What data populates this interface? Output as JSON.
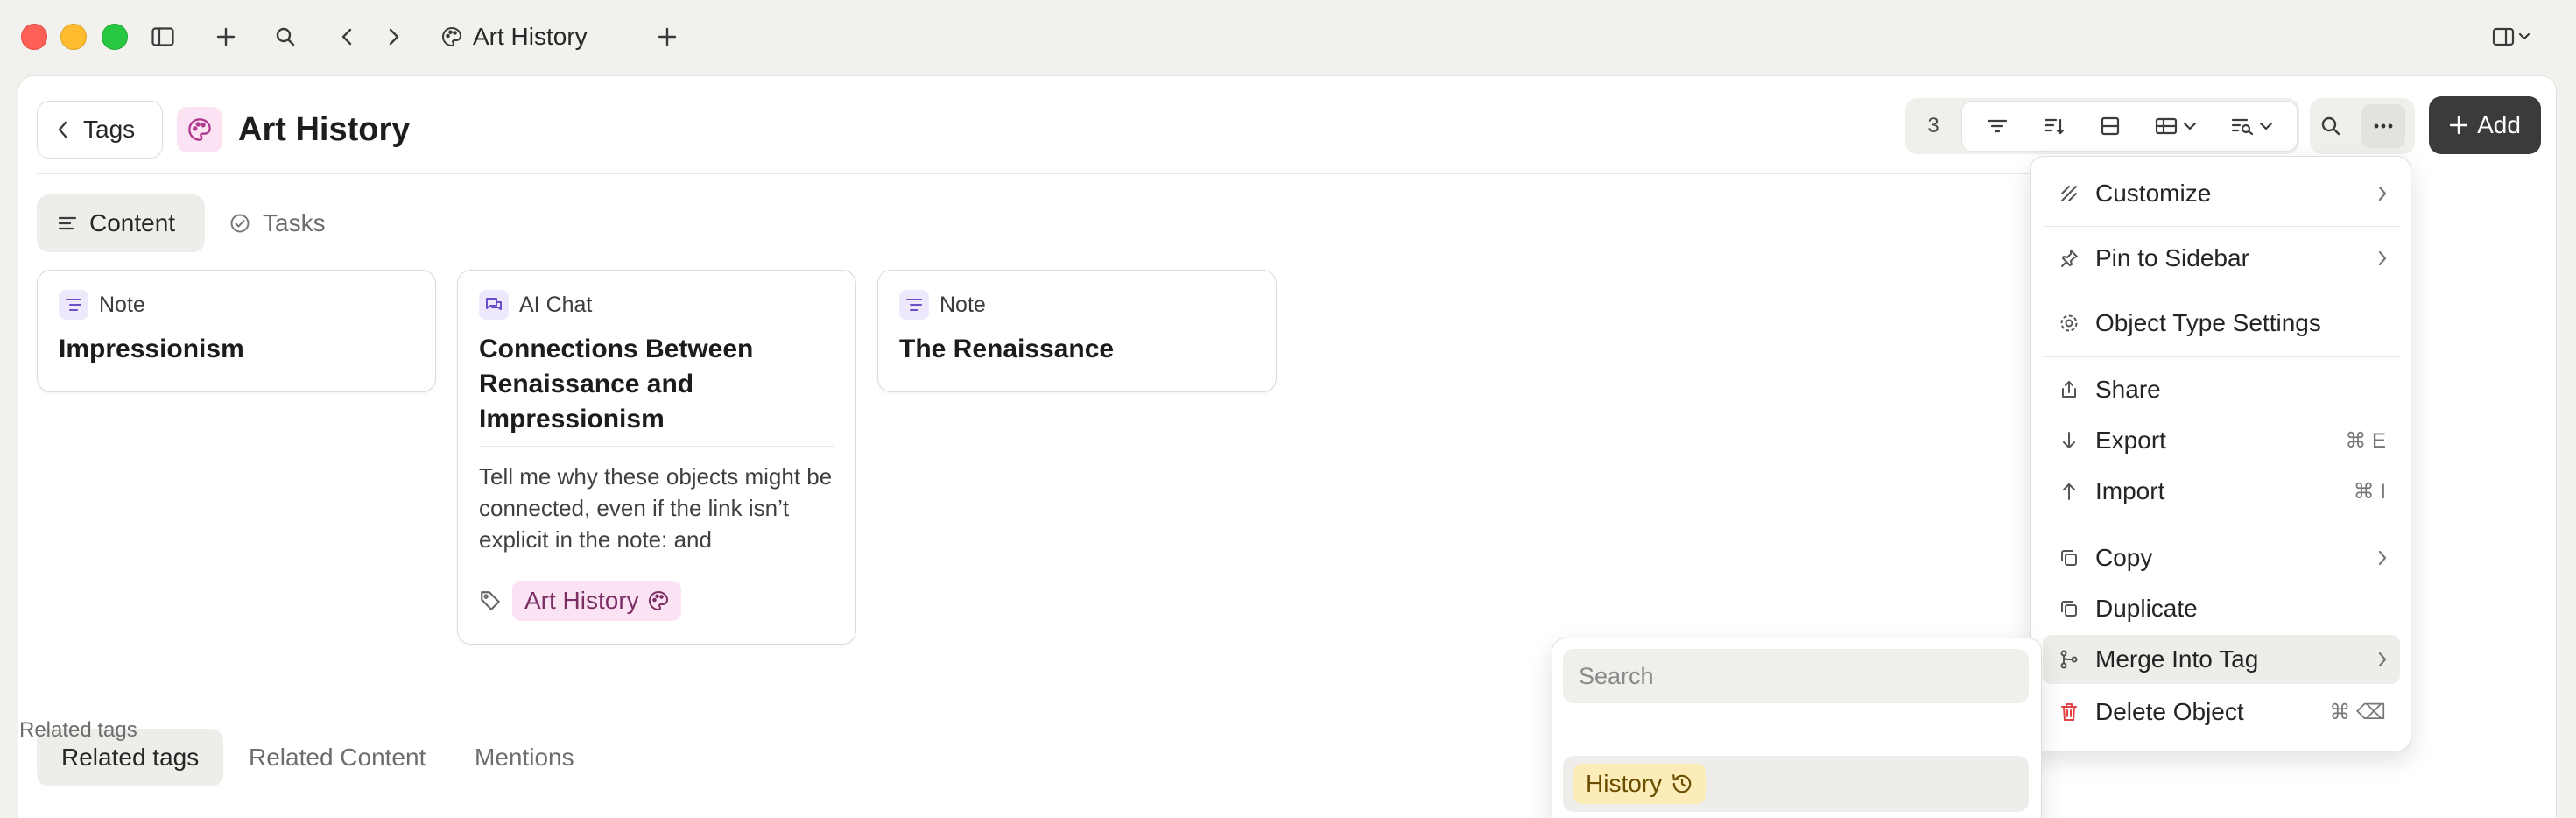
{
  "titlebar": {
    "tab_title": "Art History"
  },
  "header": {
    "back_label": "Tags",
    "title": "Art History",
    "object_count": "3",
    "add_label": "Add"
  },
  "view_tabs": [
    {
      "label": "Content",
      "active": true
    },
    {
      "label": "Tasks",
      "active": false
    }
  ],
  "cards": [
    {
      "type": "Note",
      "title": "Impressionism"
    },
    {
      "type": "AI Chat",
      "title": "Connections Between Renaissance and Impressionism",
      "snippet": "Tell me why these objects might be connected, even if the link isn’t explicit in the note: and",
      "tag": "Art History"
    },
    {
      "type": "Note",
      "title": "The Renaissance"
    }
  ],
  "bottom_tabs": [
    {
      "label": "Related tags",
      "active": true
    },
    {
      "label": "Related Content",
      "active": false
    },
    {
      "label": "Mentions",
      "active": false
    }
  ],
  "menu": {
    "items": [
      {
        "label": "Customize",
        "icon": "customize-icon",
        "submenu": true
      },
      {
        "label": "Pin to Sidebar",
        "icon": "pin-icon",
        "submenu": true
      },
      {
        "label": "Object Type Settings",
        "icon": "gear-icon"
      },
      {
        "label": "Share",
        "icon": "share-icon"
      },
      {
        "label": "Export",
        "icon": "export-icon",
        "shortcut": "⌘ E"
      },
      {
        "label": "Import",
        "icon": "import-icon",
        "shortcut": "⌘ I"
      },
      {
        "label": "Copy",
        "icon": "copy-icon",
        "submenu": true
      },
      {
        "label": "Duplicate",
        "icon": "duplicate-icon"
      },
      {
        "label": "Merge Into Tag",
        "icon": "merge-icon",
        "submenu": true,
        "highlighted": true
      },
      {
        "label": "Delete Object",
        "icon": "trash-icon",
        "shortcut": "⌘ ⌫",
        "danger": true
      }
    ]
  },
  "submenu": {
    "search_placeholder": "Search",
    "section_label": "Related tags",
    "items": [
      {
        "label": "History"
      }
    ]
  },
  "colors": {
    "accent_dark": "#3b3b3b",
    "tag_pink": "#fbe3f4",
    "tag_yellow": "#fbecb8",
    "danger": "#e04343"
  }
}
